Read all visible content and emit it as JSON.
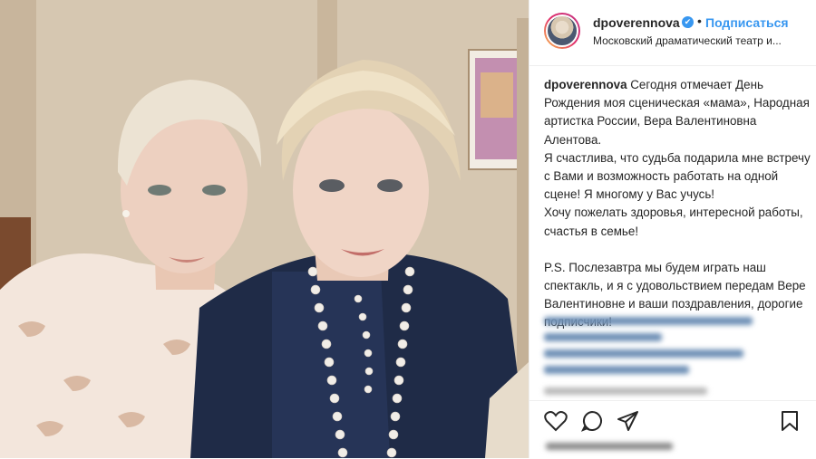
{
  "post": {
    "username": "dpoverennova",
    "verified_mark": "✔",
    "separator": "•",
    "follow_label": "Подписаться",
    "location": "Московский драматический театр и...",
    "caption": {
      "author": "dpoverennova",
      "line1": "Сегодня отмечает День Рождения моя сценическая «мама», Народная артистка России, Вера Валентиновна Алентова.",
      "line2": "Я счастлива, что судьба подарила мне встречу с Вами и возможность работать на одной сцене! Я многому у Вас учусь!",
      "line3": "Хочу пожелать здоровья, интересной работы, счастья в семье!",
      "ps": "P.S. Послезавтра мы будем играть наш спектакль, и я с удовольствием передам Вере Валентиновне и ваши поздравления, дорогие подписчики!"
    }
  },
  "icons": {
    "avatar": "avatar",
    "heart": "heart-icon",
    "comment": "comment-icon",
    "share": "share-icon",
    "bookmark": "bookmark-icon"
  },
  "colors": {
    "link": "#3897f0",
    "text": "#262626",
    "hashtag": "#003569"
  }
}
